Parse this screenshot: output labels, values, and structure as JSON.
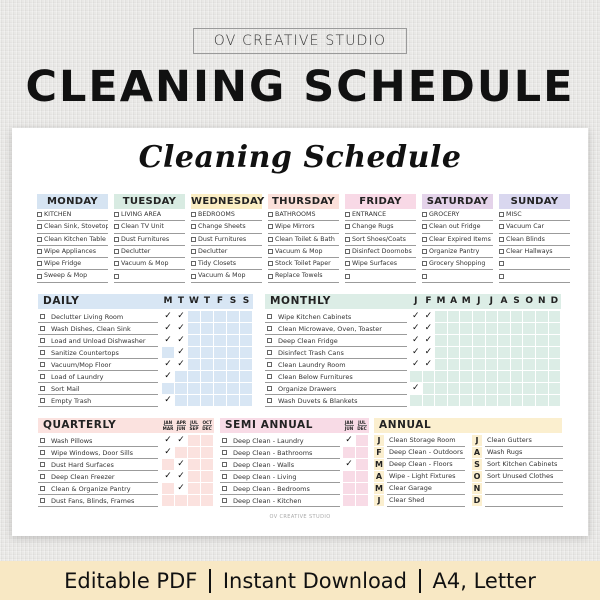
{
  "brand": "OV CREATIVE STUDIO",
  "main_title": "CLEANING SCHEDULE",
  "paper": {
    "script_title": "Cleaning Schedule",
    "credit": "OV CREATIVE STUDIO"
  },
  "colors": {
    "monday": "#d6e4f2",
    "tuesday": "#d8ebe2",
    "wednesday": "#fbeec4",
    "thursday": "#fbe0da",
    "friday": "#f8d9e6",
    "saturday": "#e4d3ea",
    "sunday": "#d9d7ef",
    "daily": "#d8e6f4",
    "monthly": "#dcede6",
    "quarterly": "#fbe2df",
    "semi_annual": "#f8dbe6",
    "annual": "#fbefcf",
    "footer": "#f8e8c4"
  },
  "weekly": [
    {
      "day": "MONDAY",
      "items": [
        "KITCHEN",
        "Clean Sink, Stovetop",
        "Clean Kitchen Table",
        "Wipe Appliances",
        "Wipe Fridge",
        "Sweep & Mop"
      ]
    },
    {
      "day": "TUESDAY",
      "items": [
        "LIVING AREA",
        "Clean TV Unit",
        "Dust Furnitures",
        "Declutter",
        "Vacuum & Mop",
        ""
      ]
    },
    {
      "day": "WEDNESDAY",
      "items": [
        "BEDROOMS",
        "Change Sheets",
        "Dust Furnitures",
        "Declutter",
        "Tidy Closets",
        "Vacuum & Mop"
      ]
    },
    {
      "day": "THURSDAY",
      "items": [
        "BATHROOMS",
        "Wipe Mirrors",
        "Clean Toilet & Bath",
        "Vacuum & Mop",
        "Stock Toilet Paper",
        "Replace Towels"
      ]
    },
    {
      "day": "FRIDAY",
      "items": [
        "ENTRANCE",
        "Change Rugs",
        "Sort Shoes/Coats",
        "Disinfect Doornobs",
        "Wipe Surfaces",
        ""
      ]
    },
    {
      "day": "SATURDAY",
      "items": [
        "GROCERY",
        "Clean out Fridge",
        "Clear Expired Items",
        "Organize Pantry",
        "Grocery Shopping",
        ""
      ]
    },
    {
      "day": "SUNDAY",
      "items": [
        "MISC",
        "Vacuum Car",
        "Clean Blinds",
        "Clear Hallways",
        "",
        ""
      ]
    }
  ],
  "daily": {
    "title": "DAILY",
    "columns": [
      "M",
      "T",
      "W",
      "T",
      "F",
      "S",
      "S"
    ],
    "check_mark": "✓",
    "rows": [
      {
        "task": "Declutter Living Room",
        "checks": [
          1,
          1,
          0,
          0,
          0,
          0,
          0
        ]
      },
      {
        "task": "Wash Dishes, Clean Sink",
        "checks": [
          1,
          1,
          0,
          0,
          0,
          0,
          0
        ]
      },
      {
        "task": "Load and Unload Dishwasher",
        "checks": [
          1,
          1,
          0,
          0,
          0,
          0,
          0
        ]
      },
      {
        "task": "Sanitize Countertops",
        "checks": [
          0,
          1,
          0,
          0,
          0,
          0,
          0
        ]
      },
      {
        "task": "Vacuum/Mop Floor",
        "checks": [
          1,
          1,
          0,
          0,
          0,
          0,
          0
        ]
      },
      {
        "task": "Load of Laundry",
        "checks": [
          1,
          0,
          0,
          0,
          0,
          0,
          0
        ]
      },
      {
        "task": "Sort Mail",
        "checks": [
          0,
          0,
          0,
          0,
          0,
          0,
          0
        ]
      },
      {
        "task": "Empty Trash",
        "checks": [
          1,
          0,
          0,
          0,
          0,
          0,
          0
        ]
      }
    ]
  },
  "monthly": {
    "title": "MONTHLY",
    "columns": [
      "J",
      "F",
      "M",
      "A",
      "M",
      "J",
      "J",
      "A",
      "S",
      "O",
      "N",
      "D"
    ],
    "rows": [
      {
        "task": "Wipe Kitchen Cabinets",
        "checks": [
          1,
          1,
          0,
          0,
          0,
          0,
          0,
          0,
          0,
          0,
          0,
          0
        ]
      },
      {
        "task": "Clean Microwave, Oven, Toaster",
        "checks": [
          1,
          1,
          0,
          0,
          0,
          0,
          0,
          0,
          0,
          0,
          0,
          0
        ]
      },
      {
        "task": "Deep Clean Fridge",
        "checks": [
          1,
          1,
          0,
          0,
          0,
          0,
          0,
          0,
          0,
          0,
          0,
          0
        ]
      },
      {
        "task": "Disinfect Trash Cans",
        "checks": [
          1,
          1,
          0,
          0,
          0,
          0,
          0,
          0,
          0,
          0,
          0,
          0
        ]
      },
      {
        "task": "Clean Laundry Room",
        "checks": [
          1,
          1,
          0,
          0,
          0,
          0,
          0,
          0,
          0,
          0,
          0,
          0
        ]
      },
      {
        "task": "Clean Below Furnitures",
        "checks": [
          0,
          0,
          0,
          0,
          0,
          0,
          0,
          0,
          0,
          0,
          0,
          0
        ]
      },
      {
        "task": "Organize Drawers",
        "checks": [
          1,
          0,
          0,
          0,
          0,
          0,
          0,
          0,
          0,
          0,
          0,
          0
        ]
      },
      {
        "task": "Wash Duvets & Blankets",
        "checks": [
          0,
          0,
          0,
          0,
          0,
          0,
          0,
          0,
          0,
          0,
          0,
          0
        ]
      }
    ]
  },
  "quarterly": {
    "title": "QUARTERLY",
    "columns": [
      [
        "JAN",
        "MAR"
      ],
      [
        "APR",
        "JUN"
      ],
      [
        "JUL",
        "SEP"
      ],
      [
        "OCT",
        "DEC"
      ]
    ],
    "rows": [
      {
        "task": "Wash Pillows",
        "checks": [
          1,
          1,
          0,
          0
        ]
      },
      {
        "task": "Wipe Windows, Door Sills",
        "checks": [
          1,
          0,
          0,
          0
        ]
      },
      {
        "task": "Dust Hard Surfaces",
        "checks": [
          0,
          1,
          0,
          0
        ]
      },
      {
        "task": "Deep Clean Freezer",
        "checks": [
          1,
          1,
          0,
          0
        ]
      },
      {
        "task": "Clean & Organize Pantry",
        "checks": [
          0,
          1,
          0,
          0
        ]
      },
      {
        "task": "Dust Fans, Blinds, Frames",
        "checks": [
          0,
          0,
          0,
          0
        ]
      }
    ]
  },
  "semi_annual": {
    "title": "SEMI ANNUAL",
    "columns": [
      [
        "JAN",
        "JUN"
      ],
      [
        "JUL",
        "DEC"
      ]
    ],
    "rows": [
      {
        "task": "Deep Clean - Laundry",
        "checks": [
          1,
          0
        ]
      },
      {
        "task": "Deep Clean - Bathrooms",
        "checks": [
          0,
          0
        ]
      },
      {
        "task": "Deep Clean - Walls",
        "checks": [
          1,
          0
        ]
      },
      {
        "task": "Deep Clean - Living",
        "checks": [
          0,
          0
        ]
      },
      {
        "task": "Deep Clean - Bedrooms",
        "checks": [
          0,
          0
        ]
      },
      {
        "task": "Deep Clean - Kitchen",
        "checks": [
          0,
          0
        ]
      }
    ]
  },
  "annual": {
    "title": "ANNUAL",
    "left": [
      {
        "month": "J",
        "task": "Clean Storage Room"
      },
      {
        "month": "F",
        "task": "Deep Clean - Outdoors"
      },
      {
        "month": "M",
        "task": "Deep Clean - Floors"
      },
      {
        "month": "A",
        "task": "Wipe - Light Fixtures"
      },
      {
        "month": "M",
        "task": "Clear Garage"
      },
      {
        "month": "J",
        "task": "Clear Shed"
      }
    ],
    "right": [
      {
        "month": "J",
        "task": "Clean Gutters"
      },
      {
        "month": "A",
        "task": "Wash Rugs"
      },
      {
        "month": "S",
        "task": "Sort Kitchen Cabinets"
      },
      {
        "month": "O",
        "task": "Sort Unused Clothes"
      },
      {
        "month": "N",
        "task": ""
      },
      {
        "month": "D",
        "task": ""
      }
    ]
  },
  "footer": {
    "items": [
      "Editable PDF",
      "Instant Download",
      "A4, Letter"
    ]
  }
}
